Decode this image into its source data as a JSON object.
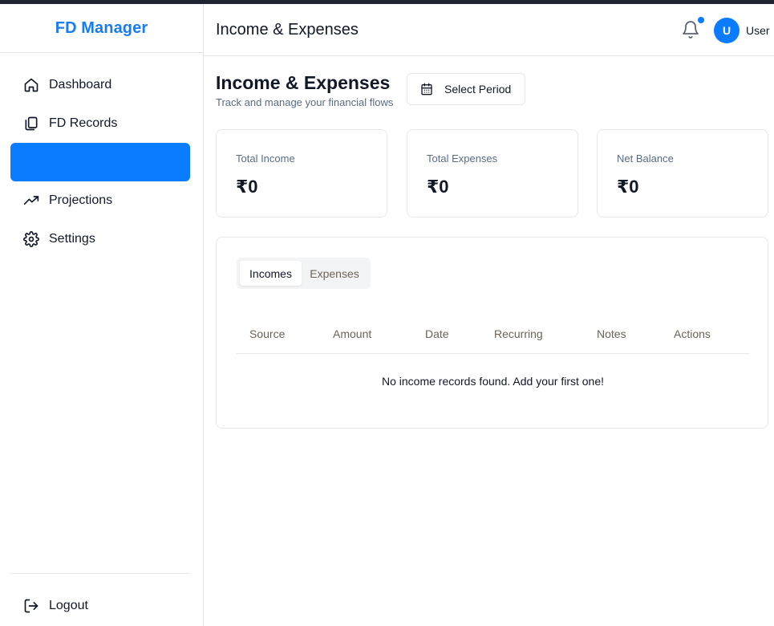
{
  "sidebar": {
    "brand": "FD Manager",
    "items": [
      {
        "label": "Dashboard",
        "icon": "home-icon",
        "active": false
      },
      {
        "label": "FD Records",
        "icon": "copy-icon",
        "active": false
      },
      {
        "label": "",
        "icon": "",
        "active": true
      },
      {
        "label": "Projections",
        "icon": "trending-up-icon",
        "active": false
      },
      {
        "label": "Settings",
        "icon": "gear-icon",
        "active": false
      }
    ],
    "logout_label": "Logout"
  },
  "header": {
    "title": "Income & Expenses",
    "user_initial": "U",
    "user_name": "User",
    "has_notification": true
  },
  "main": {
    "title": "Income & Expenses",
    "subtitle": "Track and manage your financial flows",
    "period_button_label": "Select Period",
    "cards": [
      {
        "label": "Total Income",
        "value": "₹0"
      },
      {
        "label": "Total Expenses",
        "value": "₹0"
      },
      {
        "label": "Net Balance",
        "value": "₹0"
      }
    ],
    "tabs": [
      {
        "label": "Incomes",
        "active": true
      },
      {
        "label": "Expenses",
        "active": false
      }
    ],
    "table": {
      "columns": [
        "Source",
        "Amount",
        "Date",
        "Recurring",
        "Notes",
        "Actions"
      ],
      "empty_message": "No income records found. Add your first one!"
    }
  },
  "colors": {
    "accent": "#0a7cff",
    "brand": "#1a7cf2",
    "muted_text": "#5b6b85",
    "border": "#e5e7eb"
  }
}
